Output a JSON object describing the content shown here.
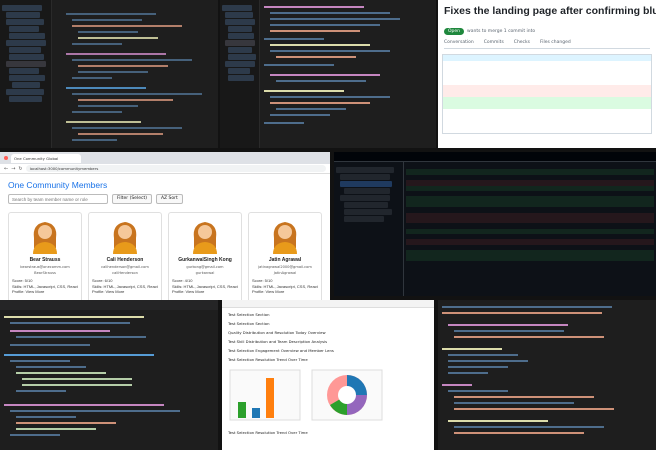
{
  "pr_view": {
    "title": "Fixes the landing page after confirming blue square request #",
    "status": "Open",
    "subtitle": "wants to merge 1 commit into",
    "tabs": [
      "Conversation",
      "Commits",
      "Checks",
      "Files changed"
    ]
  },
  "browser": {
    "tab_title": "One Community Global",
    "url": "localhost:3000/communitymembers"
  },
  "members_page": {
    "title": "One Community Members",
    "search_placeholder": "Search by team member name or role",
    "filter_label": "Filter (Select)",
    "sort_label": "AZ Sort",
    "members": [
      {
        "name": "Bear Strauss",
        "email": "bearstraus@onecomm.com",
        "slack": "BearStrauss",
        "score": "Score: 5/10",
        "skills": "Skills: HTML, Javascript, CSS, React",
        "profile": "Profile: View More"
      },
      {
        "name": "Cali Henderson",
        "email": "calihenderson@gmail.com",
        "slack": "caliHenderson",
        "score": "Score: 6/10",
        "skills": "Skills: HTML, Javascript, CSS, React",
        "profile": "Profile: View More"
      },
      {
        "name": "GurkanwalSingh Kong",
        "email": "gurkong@gmail.com",
        "slack": "gurkanwal",
        "score": "Score: 4/10",
        "skills": "Skills: HTML, Javascript, CSS, React",
        "profile": "Profile: View More"
      },
      {
        "name": "Jatin Agrawal",
        "email": "jatinagrawal2000@gmail.com",
        "slack": "JatinAgrawal",
        "score": "Score: 5/10",
        "skills": "Skills: HTML, Javascript, CSS, React",
        "profile": "Profile: View More"
      }
    ]
  },
  "doc_panel": {
    "lines": [
      "Test Selection Section",
      "Test Selection Section",
      "Quality Distribution and Resolution Today Overview",
      "Test Skill Distribution and Team Description Analysis",
      "Test Selection Engagement Overview and Member Lens",
      "Test Selection Resolution Trend Over Time"
    ],
    "footer": "Test Selection Resolution Trend Over Time"
  },
  "colors": {
    "accent": "#1a73e8",
    "pr_green": "#1f883d"
  }
}
